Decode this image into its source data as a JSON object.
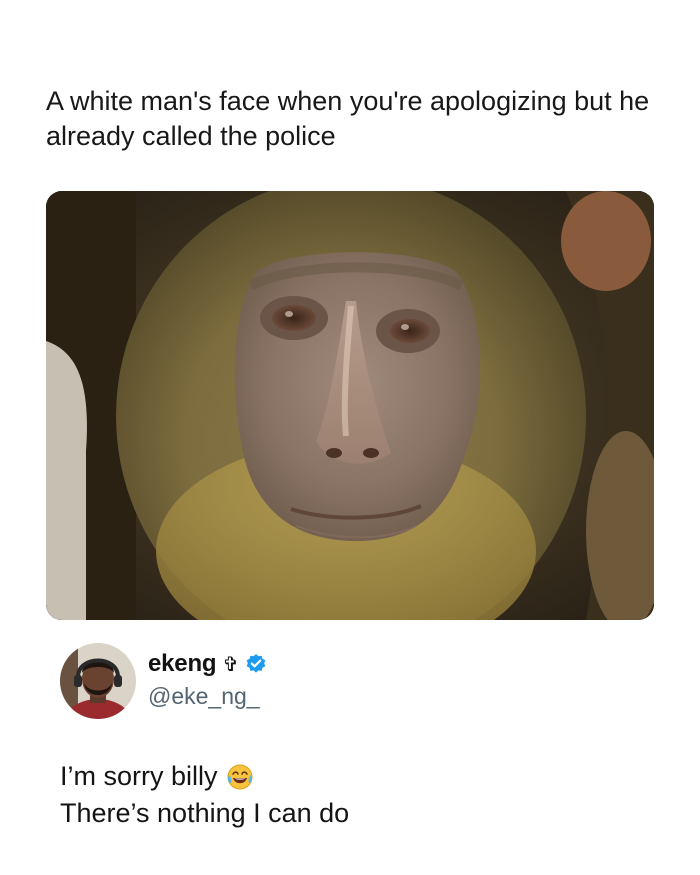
{
  "caption": "A white man's face when you're apologizing but he already called the police",
  "image": {
    "subject_icon": "monkey-face-photo"
  },
  "tweet": {
    "author": {
      "display_name": "ekeng",
      "name_symbol": "✞",
      "handle": "@eke_ng_",
      "verified": true,
      "avatar_icon": "avatar-photo"
    },
    "lines": [
      "I’m sorry billy",
      "There’s nothing I can do"
    ],
    "emoji": "face-with-tears-of-joy-icon"
  },
  "colors": {
    "background": "#ffffff",
    "verified_badge": "#1d9bf0",
    "handle": "#536471"
  }
}
